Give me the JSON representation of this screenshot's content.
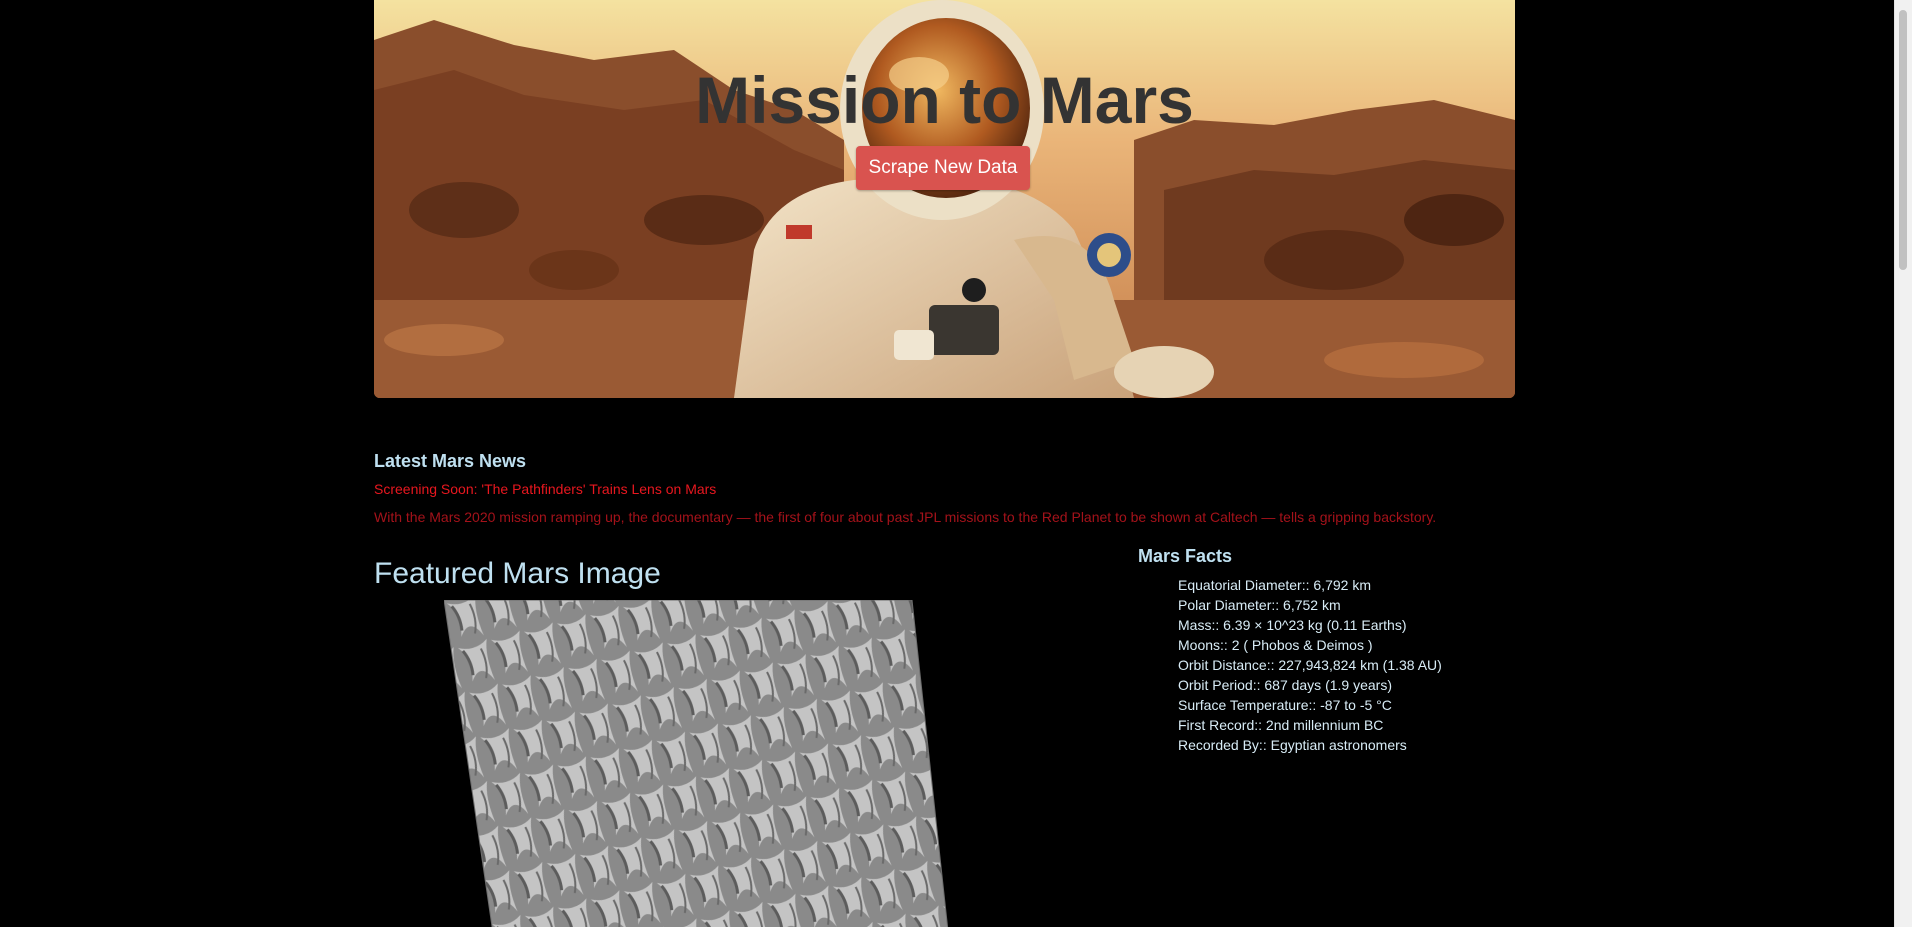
{
  "hero": {
    "title": "Mission to Mars",
    "scrape_button_label": "Scrape New Data",
    "button_color": "#d9534f"
  },
  "news": {
    "heading": "Latest Mars News",
    "title": "Screening Soon: 'The Pathfinders' Trains Lens on Mars",
    "teaser": "With the Mars 2020 mission ramping up, the documentary — the first of four about past JPL missions to the Red Planet to be shown at Caltech — tells a gripping backstory."
  },
  "featured": {
    "heading": "Featured Mars Image"
  },
  "facts": {
    "heading": "Mars Facts",
    "items": [
      "Equatorial Diameter:: 6,792 km",
      "Polar Diameter:: 6,752 km",
      "Mass:: 6.39 × 10^23 kg (0.11 Earths)",
      "Moons:: 2 ( Phobos & Deimos )",
      "Orbit Distance:: 227,943,824 km (1.38 AU)",
      "Orbit Period:: 687 days (1.9 years)",
      "Surface Temperature:: -87 to -5 °C",
      "First Record:: 2nd millennium BC",
      "Recorded By:: Egyptian astronomers"
    ]
  },
  "colors": {
    "background": "#000000",
    "heading_blue": "#bfe0f0",
    "news_title_red": "#e8171f",
    "news_teaser_red": "#a4121a"
  }
}
